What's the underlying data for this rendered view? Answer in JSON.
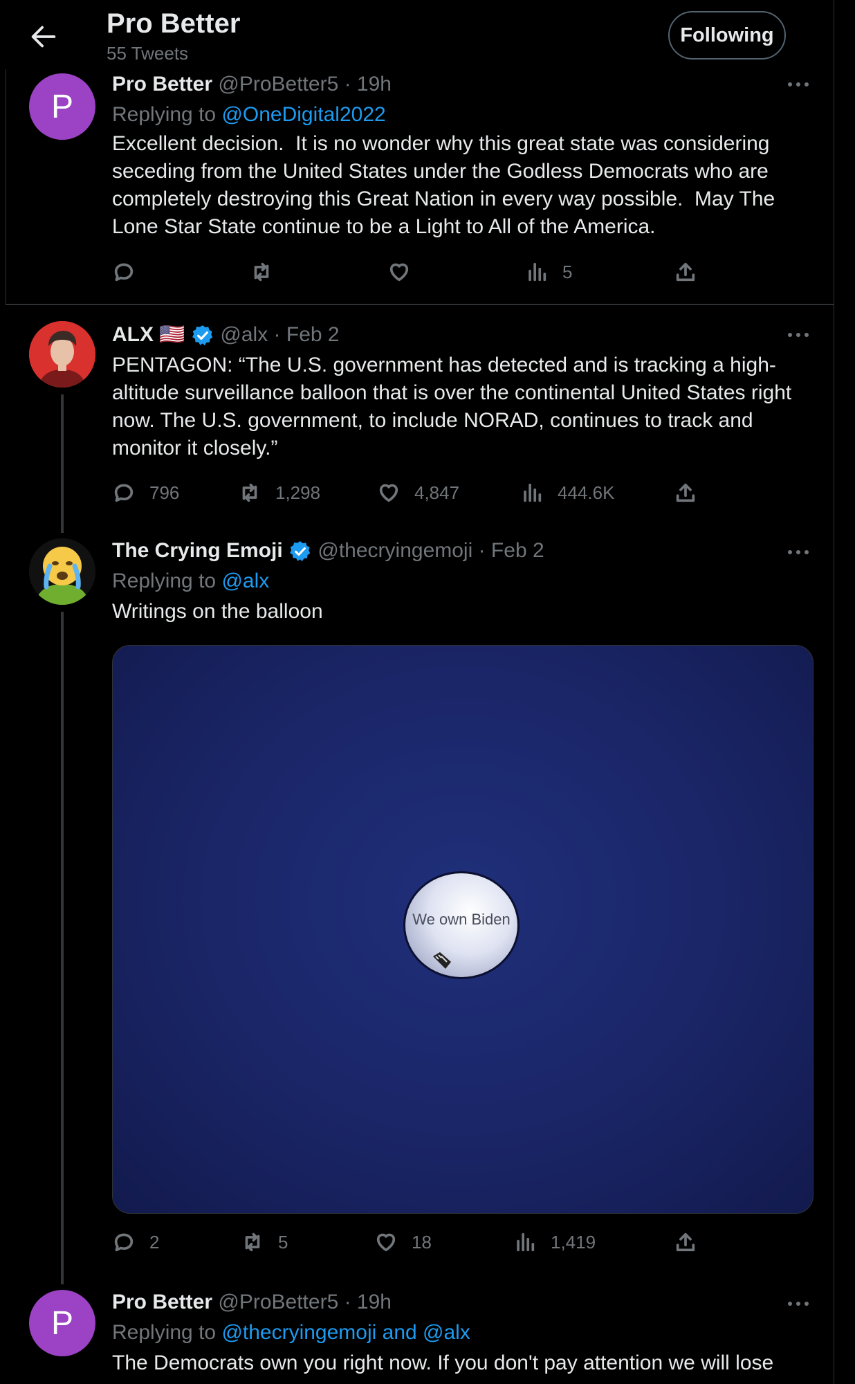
{
  "header": {
    "title": "Pro Better",
    "subtitle": "55 Tweets",
    "follow_label": "Following"
  },
  "tweets": [
    {
      "name": "Pro Better",
      "handle": "@ProBetter5",
      "time": "· 19h",
      "avatar_letter": "P",
      "replying_prefix": "Replying to ",
      "replying_to": "@OneDigital2022",
      "text": "Excellent decision.  It is no wonder why this great state was considering seceding from the United States under the Godless Democrats who are completely destroying this Great Nation in every way possible.  May The Lone Star State continue to be a Light to All of the America.",
      "stats": {
        "replies": "",
        "retweets": "",
        "likes": "",
        "views": "5"
      }
    },
    {
      "name": "ALX",
      "flag": "🇺🇸",
      "handle": "@alx",
      "time": "· Feb 2",
      "text": "PENTAGON: “The U.S. government has detected and is tracking a high-altitude surveillance balloon that is over the continental United States right now. The U.S. government, to include NORAD, continues to track and monitor it closely.”",
      "stats": {
        "replies": "796",
        "retweets": "1,298",
        "likes": "4,847",
        "views": "444.6K"
      }
    },
    {
      "name": "The Crying Emoji",
      "handle": "@thecryingemoji",
      "time": "· Feb 2",
      "replying_prefix": "Replying to ",
      "replying_to": "@alx",
      "text": "Writings on the balloon",
      "image_caption": "We own Biden",
      "stats": {
        "replies": "2",
        "retweets": "5",
        "likes": "18",
        "views": "1,419"
      }
    },
    {
      "name": "Pro Better",
      "handle": "@ProBetter5",
      "time": "· 19h",
      "avatar_letter": "P",
      "replying_prefix": "Replying to ",
      "replying_to": "@thecryingemoji and @alx",
      "text": "The Democrats own you right now.  If you don't pay attention we will lose"
    }
  ],
  "icons": {
    "back": "arrow-left-icon",
    "more": "more-horizontal-icon",
    "reply": "reply-icon",
    "retweet": "retweet-icon",
    "like": "heart-icon",
    "views": "views-icon",
    "share": "share-icon",
    "verified": "verified-badge-icon"
  },
  "colors": {
    "background": "#000000",
    "accent": "#1d9bf0",
    "muted": "#71767b",
    "avatar_purple": "#9c42c4"
  }
}
